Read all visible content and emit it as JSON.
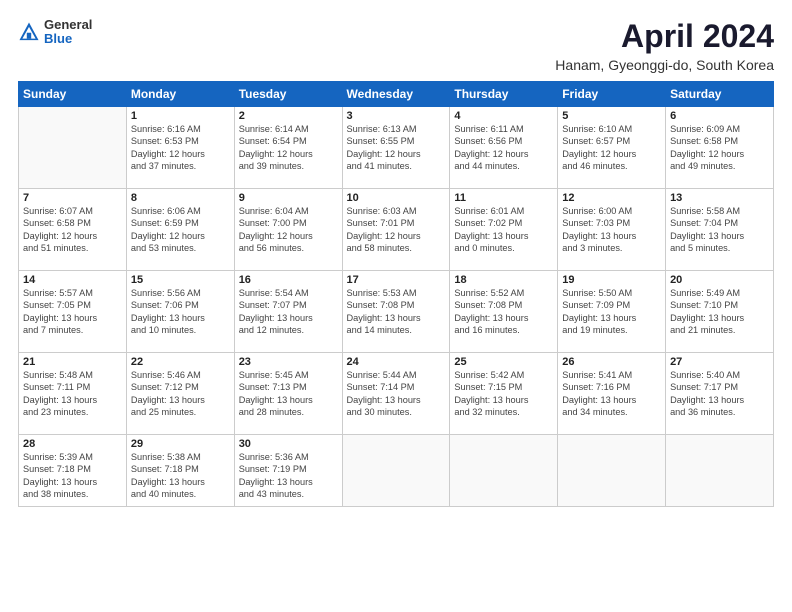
{
  "header": {
    "logo": {
      "general": "General",
      "blue": "Blue"
    },
    "title": "April 2024",
    "location": "Hanam, Gyeonggi-do, South Korea"
  },
  "calendar": {
    "days_of_week": [
      "Sunday",
      "Monday",
      "Tuesday",
      "Wednesday",
      "Thursday",
      "Friday",
      "Saturday"
    ],
    "weeks": [
      [
        {
          "day": "",
          "content": ""
        },
        {
          "day": "1",
          "content": "Sunrise: 6:16 AM\nSunset: 6:53 PM\nDaylight: 12 hours\nand 37 minutes."
        },
        {
          "day": "2",
          "content": "Sunrise: 6:14 AM\nSunset: 6:54 PM\nDaylight: 12 hours\nand 39 minutes."
        },
        {
          "day": "3",
          "content": "Sunrise: 6:13 AM\nSunset: 6:55 PM\nDaylight: 12 hours\nand 41 minutes."
        },
        {
          "day": "4",
          "content": "Sunrise: 6:11 AM\nSunset: 6:56 PM\nDaylight: 12 hours\nand 44 minutes."
        },
        {
          "day": "5",
          "content": "Sunrise: 6:10 AM\nSunset: 6:57 PM\nDaylight: 12 hours\nand 46 minutes."
        },
        {
          "day": "6",
          "content": "Sunrise: 6:09 AM\nSunset: 6:58 PM\nDaylight: 12 hours\nand 49 minutes."
        }
      ],
      [
        {
          "day": "7",
          "content": "Sunrise: 6:07 AM\nSunset: 6:58 PM\nDaylight: 12 hours\nand 51 minutes."
        },
        {
          "day": "8",
          "content": "Sunrise: 6:06 AM\nSunset: 6:59 PM\nDaylight: 12 hours\nand 53 minutes."
        },
        {
          "day": "9",
          "content": "Sunrise: 6:04 AM\nSunset: 7:00 PM\nDaylight: 12 hours\nand 56 minutes."
        },
        {
          "day": "10",
          "content": "Sunrise: 6:03 AM\nSunset: 7:01 PM\nDaylight: 12 hours\nand 58 minutes."
        },
        {
          "day": "11",
          "content": "Sunrise: 6:01 AM\nSunset: 7:02 PM\nDaylight: 13 hours\nand 0 minutes."
        },
        {
          "day": "12",
          "content": "Sunrise: 6:00 AM\nSunset: 7:03 PM\nDaylight: 13 hours\nand 3 minutes."
        },
        {
          "day": "13",
          "content": "Sunrise: 5:58 AM\nSunset: 7:04 PM\nDaylight: 13 hours\nand 5 minutes."
        }
      ],
      [
        {
          "day": "14",
          "content": "Sunrise: 5:57 AM\nSunset: 7:05 PM\nDaylight: 13 hours\nand 7 minutes."
        },
        {
          "day": "15",
          "content": "Sunrise: 5:56 AM\nSunset: 7:06 PM\nDaylight: 13 hours\nand 10 minutes."
        },
        {
          "day": "16",
          "content": "Sunrise: 5:54 AM\nSunset: 7:07 PM\nDaylight: 13 hours\nand 12 minutes."
        },
        {
          "day": "17",
          "content": "Sunrise: 5:53 AM\nSunset: 7:08 PM\nDaylight: 13 hours\nand 14 minutes."
        },
        {
          "day": "18",
          "content": "Sunrise: 5:52 AM\nSunset: 7:08 PM\nDaylight: 13 hours\nand 16 minutes."
        },
        {
          "day": "19",
          "content": "Sunrise: 5:50 AM\nSunset: 7:09 PM\nDaylight: 13 hours\nand 19 minutes."
        },
        {
          "day": "20",
          "content": "Sunrise: 5:49 AM\nSunset: 7:10 PM\nDaylight: 13 hours\nand 21 minutes."
        }
      ],
      [
        {
          "day": "21",
          "content": "Sunrise: 5:48 AM\nSunset: 7:11 PM\nDaylight: 13 hours\nand 23 minutes."
        },
        {
          "day": "22",
          "content": "Sunrise: 5:46 AM\nSunset: 7:12 PM\nDaylight: 13 hours\nand 25 minutes."
        },
        {
          "day": "23",
          "content": "Sunrise: 5:45 AM\nSunset: 7:13 PM\nDaylight: 13 hours\nand 28 minutes."
        },
        {
          "day": "24",
          "content": "Sunrise: 5:44 AM\nSunset: 7:14 PM\nDaylight: 13 hours\nand 30 minutes."
        },
        {
          "day": "25",
          "content": "Sunrise: 5:42 AM\nSunset: 7:15 PM\nDaylight: 13 hours\nand 32 minutes."
        },
        {
          "day": "26",
          "content": "Sunrise: 5:41 AM\nSunset: 7:16 PM\nDaylight: 13 hours\nand 34 minutes."
        },
        {
          "day": "27",
          "content": "Sunrise: 5:40 AM\nSunset: 7:17 PM\nDaylight: 13 hours\nand 36 minutes."
        }
      ],
      [
        {
          "day": "28",
          "content": "Sunrise: 5:39 AM\nSunset: 7:18 PM\nDaylight: 13 hours\nand 38 minutes."
        },
        {
          "day": "29",
          "content": "Sunrise: 5:38 AM\nSunset: 7:18 PM\nDaylight: 13 hours\nand 40 minutes."
        },
        {
          "day": "30",
          "content": "Sunrise: 5:36 AM\nSunset: 7:19 PM\nDaylight: 13 hours\nand 43 minutes."
        },
        {
          "day": "",
          "content": ""
        },
        {
          "day": "",
          "content": ""
        },
        {
          "day": "",
          "content": ""
        },
        {
          "day": "",
          "content": ""
        }
      ]
    ]
  }
}
